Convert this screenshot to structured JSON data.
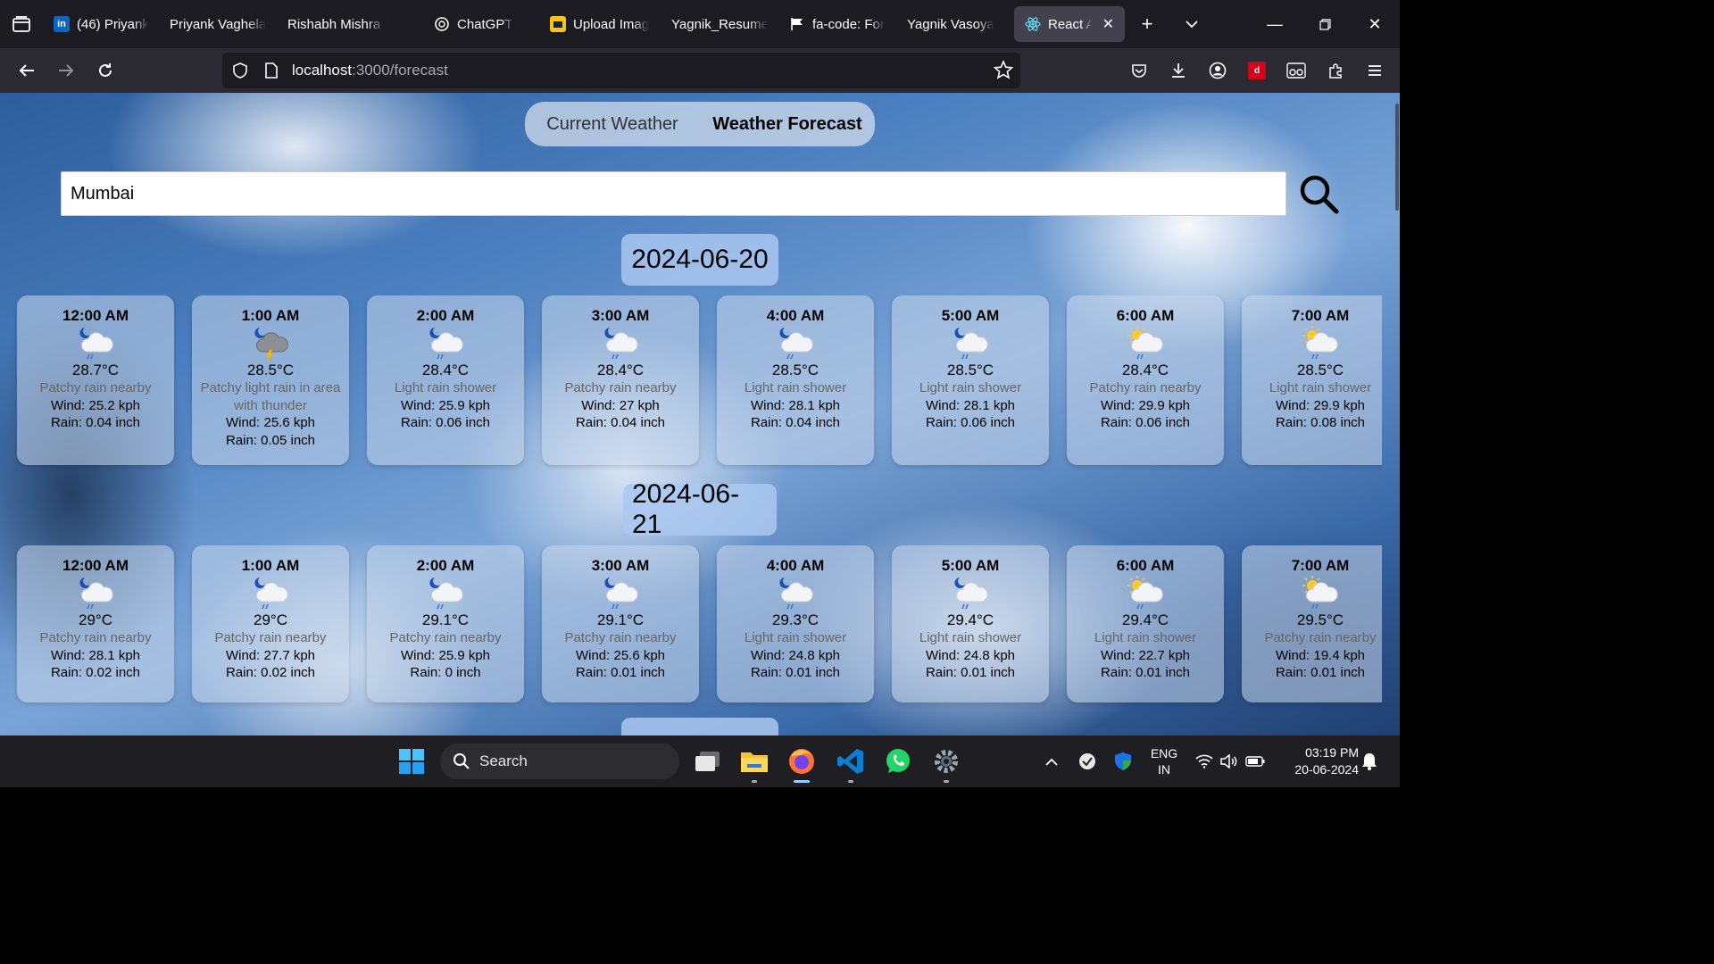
{
  "browser": {
    "tabs": [
      {
        "label": "(46) Priyank",
        "fav": "in",
        "favColor": "#0a66c2"
      },
      {
        "label": "Priyank Vaghela",
        "fav": "",
        "favColor": ""
      },
      {
        "label": "Rishabh Mishra |",
        "fav": "",
        "favColor": ""
      },
      {
        "label": "ChatGPT",
        "fav": "chatgpt",
        "favColor": "#ffffff"
      },
      {
        "label": "Upload Imag",
        "fav": "upload",
        "favColor": "#f5c518"
      },
      {
        "label": "Yagnik_Resume.",
        "fav": "",
        "favColor": ""
      },
      {
        "label": "fa-code: For",
        "fav": "flag",
        "favColor": "#ffffff"
      },
      {
        "label": "Yagnik Vasoya",
        "fav": "",
        "favColor": ""
      },
      {
        "label": "React App",
        "fav": "react",
        "favColor": "#61dafb"
      }
    ],
    "url_host": "localhost",
    "url_path": ":3000/forecast"
  },
  "app": {
    "nav": {
      "current": "Current Weather",
      "forecast": "Weather Forecast"
    },
    "search": {
      "value": "Mumbai"
    },
    "days": [
      {
        "date": "2024-06-20",
        "hours": [
          {
            "time": "12:00 AM",
            "icon": "night-cloud-rain",
            "temp": "28.7°C",
            "cond": "Patchy rain nearby",
            "wind": "Wind: 25.2 kph",
            "rain": "Rain: 0.04 inch"
          },
          {
            "time": "1:00 AM",
            "icon": "thunder-rain",
            "temp": "28.5°C",
            "cond": "Patchy light rain in area with thunder",
            "wind": "Wind: 25.6 kph",
            "rain": "Rain: 0.05 inch"
          },
          {
            "time": "2:00 AM",
            "icon": "night-cloud-rain",
            "temp": "28.4°C",
            "cond": "Light rain shower",
            "wind": "Wind: 25.9 kph",
            "rain": "Rain: 0.06 inch"
          },
          {
            "time": "3:00 AM",
            "icon": "night-cloud-rain",
            "temp": "28.4°C",
            "cond": "Patchy rain nearby",
            "wind": "Wind: 27 kph",
            "rain": "Rain: 0.04 inch"
          },
          {
            "time": "4:00 AM",
            "icon": "night-cloud-rain",
            "temp": "28.5°C",
            "cond": "Light rain shower",
            "wind": "Wind: 28.1 kph",
            "rain": "Rain: 0.04 inch"
          },
          {
            "time": "5:00 AM",
            "icon": "night-cloud-rain",
            "temp": "28.5°C",
            "cond": "Light rain shower",
            "wind": "Wind: 28.1 kph",
            "rain": "Rain: 0.06 inch"
          },
          {
            "time": "6:00 AM",
            "icon": "sun-cloud-rain",
            "temp": "28.4°C",
            "cond": "Patchy rain nearby",
            "wind": "Wind: 29.9 kph",
            "rain": "Rain: 0.06 inch"
          },
          {
            "time": "7:00 AM",
            "icon": "sun-cloud-rain",
            "temp": "28.5°C",
            "cond": "Light rain shower",
            "wind": "Wind: 29.9 kph",
            "rain": "Rain: 0.08 inch"
          }
        ]
      },
      {
        "date": "2024-06-21",
        "hours": [
          {
            "time": "12:00 AM",
            "icon": "night-cloud-rain",
            "temp": "29°C",
            "cond": "Patchy rain nearby",
            "wind": "Wind: 28.1 kph",
            "rain": "Rain: 0.02 inch"
          },
          {
            "time": "1:00 AM",
            "icon": "night-cloud-rain",
            "temp": "29°C",
            "cond": "Patchy rain nearby",
            "wind": "Wind: 27.7 kph",
            "rain": "Rain: 0.02 inch"
          },
          {
            "time": "2:00 AM",
            "icon": "night-cloud-rain",
            "temp": "29.1°C",
            "cond": "Patchy rain nearby",
            "wind": "Wind: 25.9 kph",
            "rain": "Rain: 0 inch"
          },
          {
            "time": "3:00 AM",
            "icon": "night-cloud-rain",
            "temp": "29.1°C",
            "cond": "Patchy rain nearby",
            "wind": "Wind: 25.6 kph",
            "rain": "Rain: 0.01 inch"
          },
          {
            "time": "4:00 AM",
            "icon": "night-cloud-rain",
            "temp": "29.3°C",
            "cond": "Light rain shower",
            "wind": "Wind: 24.8 kph",
            "rain": "Rain: 0.01 inch"
          },
          {
            "time": "5:00 AM",
            "icon": "night-cloud-rain",
            "temp": "29.4°C",
            "cond": "Light rain shower",
            "wind": "Wind: 24.8 kph",
            "rain": "Rain: 0.01 inch"
          },
          {
            "time": "6:00 AM",
            "icon": "sun-cloud-rain",
            "temp": "29.4°C",
            "cond": "Light rain shower",
            "wind": "Wind: 22.7 kph",
            "rain": "Rain: 0.01 inch"
          },
          {
            "time": "7:00 AM",
            "icon": "sun-cloud-rain",
            "temp": "29.5°C",
            "cond": "Patchy rain nearby",
            "wind": "Wind: 19.4 kph",
            "rain": "Rain: 0.01 inch"
          }
        ]
      }
    ]
  },
  "taskbar": {
    "search_label": "Search",
    "lang_line1": "ENG",
    "lang_line2": "IN",
    "time": "03:19 PM",
    "date": "20-06-2024"
  }
}
